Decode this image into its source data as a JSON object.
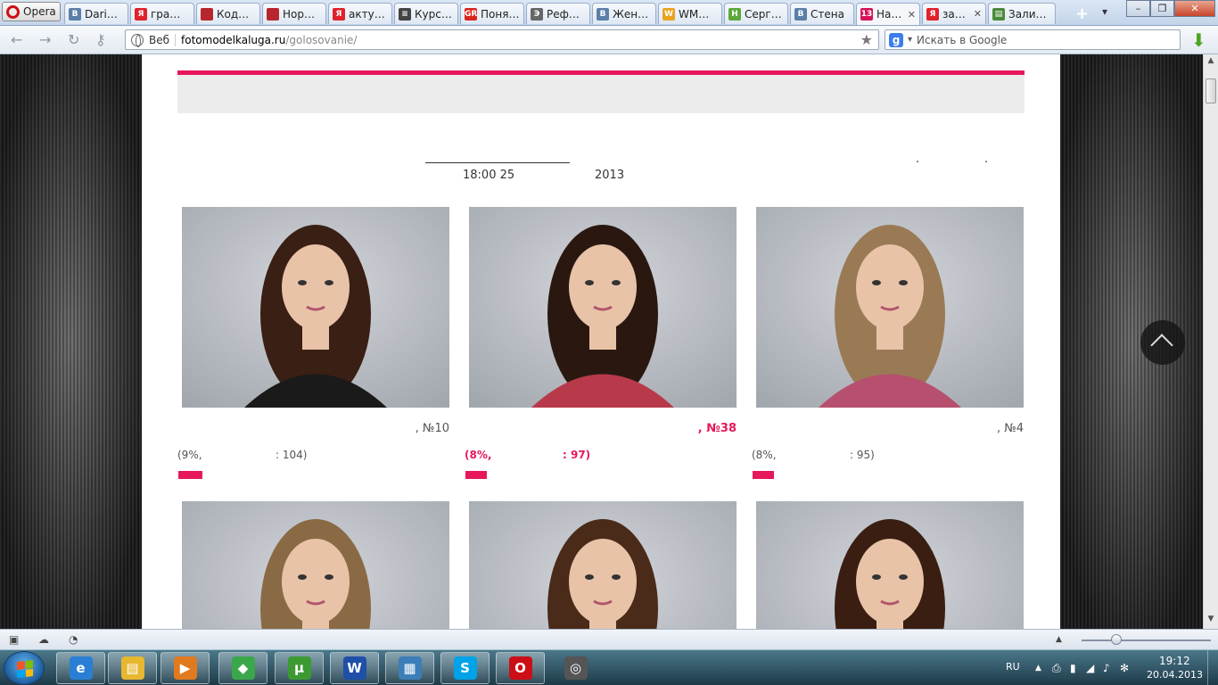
{
  "browser": {
    "menu_label": "Opera",
    "tabs": [
      {
        "label": "Dari…",
        "icon_text": "B",
        "color": "#5b7fa8"
      },
      {
        "label": "гра…",
        "icon_text": "Я",
        "color": "#e0222b"
      },
      {
        "label": "Код…",
        "icon_text": "",
        "color": "#b8262d"
      },
      {
        "label": "Норма…",
        "icon_text": "",
        "color": "#b8262d"
      },
      {
        "label": "актуал…",
        "icon_text": "Я",
        "color": "#e0222b"
      },
      {
        "label": "Курсов…",
        "icon_text": "≡",
        "color": "#444444"
      },
      {
        "label": "Понят…",
        "icon_text": "GR",
        "color": "#d8261c"
      },
      {
        "label": "Рефер…",
        "icon_text": "Э",
        "color": "#666666"
      },
      {
        "label": "Женев…",
        "icon_text": "B",
        "color": "#5b7fa8"
      },
      {
        "label": "WMma…",
        "icon_text": "W",
        "color": "#e8a321"
      },
      {
        "label": "Сергей…",
        "icon_text": "H",
        "color": "#5ba83a"
      },
      {
        "label": "Стена",
        "icon_text": "B",
        "color": "#5b7fa8"
      },
      {
        "label": "Нар…",
        "icon_text": "13",
        "color": "#d4145a",
        "active": true
      },
      {
        "label": "загруз…",
        "icon_text": "Я",
        "color": "#e0222b"
      },
      {
        "label": "Залить…",
        "icon_text": "▤",
        "color": "#4a8a3a"
      }
    ],
    "new_tab_glyph": "+",
    "tabs_menu_glyph": "▾",
    "window_controls": {
      "minimize": "–",
      "maximize": "❐",
      "close": "✕"
    }
  },
  "navbar": {
    "back": "←",
    "forward": "→",
    "reload": "↻",
    "key": "⚷",
    "address_label": "Веб",
    "url_host": "fotomodelkaluga.ru",
    "url_path": "/golosovanie/",
    "bookmark_glyph": "★",
    "search_engine": "g",
    "search_dropdown": "▾",
    "search_placeholder": "Искать в Google",
    "download_glyph": "⬇"
  },
  "page": {
    "deadline_time": "18:00 25",
    "deadline_year": "2013",
    "dot": ".",
    "accent": "#e6185a",
    "candidates": [
      {
        "num": ", №10",
        "pct": "(9%,",
        "votes": ": 104)",
        "share": 9,
        "lead": false
      },
      {
        "num": ", №38",
        "pct": "(8%,",
        "votes": ": 97)",
        "share": 8,
        "lead": true
      },
      {
        "num": ", №4",
        "pct": "(8%,",
        "votes": ": 95)",
        "share": 8,
        "lead": false
      },
      {
        "num": "",
        "pct": "",
        "votes": "",
        "share": 0,
        "lead": false
      },
      {
        "num": "",
        "pct": "",
        "votes": "",
        "share": 0,
        "lead": false
      },
      {
        "num": "",
        "pct": "",
        "votes": "",
        "share": 0,
        "lead": false
      }
    ],
    "scroll_up": "▲",
    "scroll_down": "▼"
  },
  "statusbar": {
    "panel_icon": "▣",
    "cloud_icon": "☁",
    "speed_icon": "◔",
    "arrow": "▲"
  },
  "taskbar": {
    "apps": [
      {
        "name": "ie",
        "glyph": "e",
        "color": "#2a7fd4"
      },
      {
        "name": "explorer",
        "glyph": "▤",
        "color": "#e8b730"
      },
      {
        "name": "media",
        "glyph": "▶",
        "color": "#e07a1f"
      },
      {
        "name": "sims",
        "glyph": "◆",
        "color": "#3aa84a"
      },
      {
        "name": "utorrent",
        "glyph": "µ",
        "color": "#3d9a33"
      },
      {
        "name": "word",
        "glyph": "W",
        "color": "#1f4fa8"
      },
      {
        "name": "viewer",
        "glyph": "▦",
        "color": "#3b7eb8"
      },
      {
        "name": "skype",
        "glyph": "S",
        "color": "#00a2e8"
      },
      {
        "name": "opera",
        "glyph": "O",
        "color": "#cc0f16"
      },
      {
        "name": "chrome-like",
        "glyph": "◎",
        "color": "#555555"
      }
    ],
    "language": "RU",
    "tray_arrow": "▲",
    "tray_icons": [
      "⎙",
      "▮",
      "◢",
      "♪",
      "✻"
    ],
    "time": "19:12",
    "date": "20.04.2013"
  }
}
